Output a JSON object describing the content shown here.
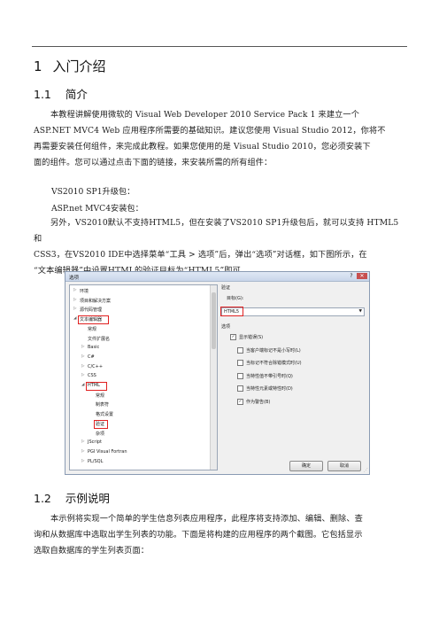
{
  "section1": {
    "num": "1",
    "title": "入门介绍"
  },
  "section11": {
    "num": "1.1",
    "title": "简介"
  },
  "intro_lines": [
    "本教程讲解使用微软的 Visual Web Developer 2010 Service Pack 1 来建立一个",
    "ASP.NET MVC4 Web 应用程序所需要的基础知识。建议您使用 Visual Studio 2012，你将不",
    "再需要安装任何组件，来完成此教程。如果您使用的是 Visual Studio 2010，您必须安装下",
    "面的组件。您可以通过点击下面的链接，来安装所需的所有组件："
  ],
  "link1": "VS2010 SP1升级包：",
  "link2": "ASP.net MVC4安装包：",
  "html5_lines": [
    "另外，VS2010默认不支持HTML5，但在安装了VS2010 SP1升级包后，就可以支持 HTML5 和",
    "CSS3，在VS2010 IDE中选择菜单“工具 > 选项”后，弹出“选项”对话框，如下图所示，在",
    "“文本编辑器”中设置HTML的验证目标为“HTML5”即可。"
  ],
  "dialog": {
    "title": "选项",
    "help": "?",
    "close": "✕",
    "tree": [
      {
        "label": "环境",
        "arrow": "▷",
        "indent": 0
      },
      {
        "label": "项目和解决方案",
        "arrow": "▷",
        "indent": 0
      },
      {
        "label": "源代码管理",
        "arrow": "▷",
        "indent": 0
      },
      {
        "label": "文本编辑器",
        "arrow": "◢",
        "indent": 0
      },
      {
        "label": "常规",
        "arrow": "",
        "indent": 1
      },
      {
        "label": "文件扩展名",
        "arrow": "",
        "indent": 1
      },
      {
        "label": "Basic",
        "arrow": "▷",
        "indent": 1
      },
      {
        "label": "C#",
        "arrow": "▷",
        "indent": 1
      },
      {
        "label": "C/C++",
        "arrow": "▷",
        "indent": 1
      },
      {
        "label": "CSS",
        "arrow": "▷",
        "indent": 1
      },
      {
        "label": "HTML",
        "arrow": "◢",
        "indent": 1
      },
      {
        "label": "常规",
        "arrow": "",
        "indent": 2
      },
      {
        "label": "制表符",
        "arrow": "",
        "indent": 2
      },
      {
        "label": "格式设置",
        "arrow": "",
        "indent": 2
      },
      {
        "label": "验证",
        "arrow": "",
        "indent": 2
      },
      {
        "label": "杂项",
        "arrow": "",
        "indent": 2
      },
      {
        "label": "JScript",
        "arrow": "▷",
        "indent": 1
      },
      {
        "label": "PGI Visual Fortran",
        "arrow": "▷",
        "indent": 1
      },
      {
        "label": "PL/SQL",
        "arrow": "▷",
        "indent": 1
      }
    ],
    "panel_title": "验证",
    "target_label": "目标(G):",
    "target_value": "HTML5",
    "options_label": "选项",
    "checks": [
      {
        "label": "显示错误(S)",
        "checked": true,
        "indent": 0
      },
      {
        "label": "当客户端标记不是小写时(L)",
        "checked": false,
        "indent": 1
      },
      {
        "label": "当标记不符合除错模式时(U)",
        "checked": false,
        "indent": 1
      },
      {
        "label": "当特性值不带引号时(Q)",
        "checked": false,
        "indent": 1
      },
      {
        "label": "当特性元素或特性时(D)",
        "checked": false,
        "indent": 1
      },
      {
        "label": "作为警告(B)",
        "checked": true,
        "indent": 1
      }
    ],
    "ok": "确定",
    "cancel": "取消"
  },
  "section12": {
    "num": "1.2",
    "title": "示例说明"
  },
  "example_lines": [
    "本示例将实现一个简单的学生信息列表应用程序，此程序将支持添加、编辑、删除、查",
    "询和从数据库中选取出学生列表的功能。下面是将构建的应用程序的两个截图。它包括显示",
    "选取自数据库的学生列表页面："
  ]
}
